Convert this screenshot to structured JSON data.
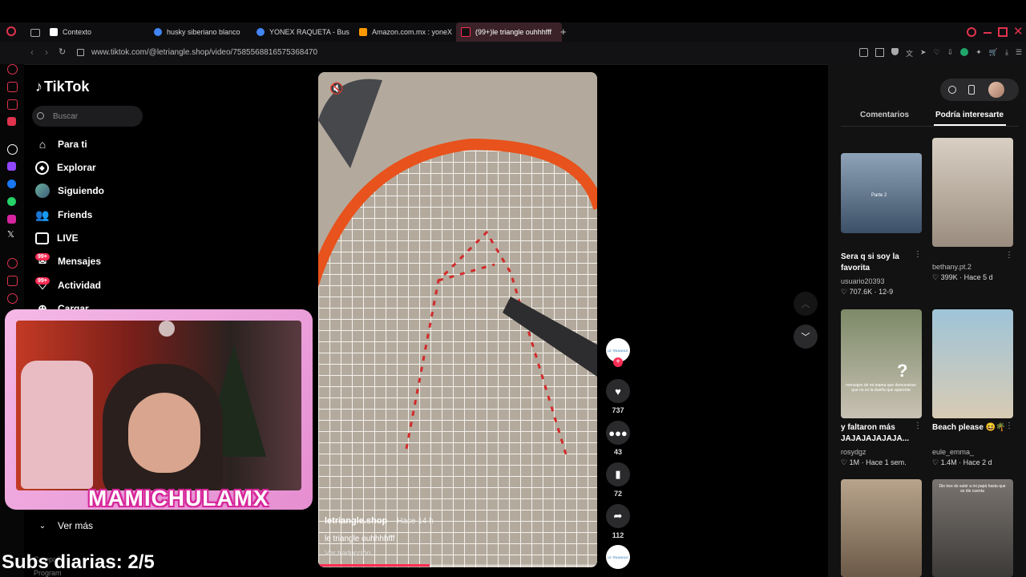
{
  "browser": {
    "tabs": [
      {
        "label": "Contexto",
        "color": "#ffffff"
      },
      {
        "label": "husky siberiano blanco -",
        "color": "#4285f4"
      },
      {
        "label": "YONEX RAQUETA - Busc",
        "color": "#4285f4"
      },
      {
        "label": "Amazon.com.mx : yoneX",
        "color": "#ff9900"
      },
      {
        "label": "(99+)le triangle ouhhhfff",
        "color": "#111111"
      }
    ],
    "new_tab": "+",
    "url": "www.tiktok.com/@letriangle.shop/video/7585568816575368470"
  },
  "tiktok": {
    "logo": "TikTok",
    "search_placeholder": "Buscar",
    "nav": [
      {
        "label": "Para ti",
        "icon": "home-icon"
      },
      {
        "label": "Explorar",
        "icon": "compass-icon"
      },
      {
        "label": "Siguiendo",
        "icon": "avatar-icon"
      },
      {
        "label": "Friends",
        "icon": "friends-icon"
      },
      {
        "label": "LIVE",
        "icon": "live-icon"
      },
      {
        "label": "Mensajes",
        "icon": "message-icon",
        "badge": "99+"
      },
      {
        "label": "Actividad",
        "icon": "activity-icon",
        "badge": "99+"
      },
      {
        "label": "Cargar",
        "icon": "upload-icon"
      }
    ],
    "ver_mas": "Ver más",
    "footer1": "Compañ",
    "footer2": "Program"
  },
  "video": {
    "author": "letriangle.shop",
    "time": "· Hace 14 h",
    "caption": "le triangle ouhhhhfff",
    "translate": "Ver traducción",
    "progress": 0.4,
    "likes": "737",
    "comments": "43",
    "saves": "72",
    "shares": "112",
    "avatar_text": "LE TRIANGLE"
  },
  "overlay": {
    "streamer": "MAMICHULAMX",
    "subs": "Subs diarias: 2/5"
  },
  "panel": {
    "tabs": [
      "Comentarios",
      "Podría interesarte"
    ],
    "active_tab": 1,
    "items": [
      {
        "caption": "Sera q si soy la favorita",
        "user": "usuario20393",
        "likes": "707.6K",
        "date": "12-9",
        "thumb_text": "Parte 2",
        "c1": "#8fa3b8",
        "c2": "#3b4f66"
      },
      {
        "caption": "",
        "user": "bethany.pt.2",
        "likes": "399K",
        "date": "Hace 5 d",
        "thumb_text": "",
        "c1": "#d9cfc3",
        "c2": "#9a8d7f"
      },
      {
        "caption": "y faltaron más JAJAJAJAJAJA...",
        "user": "rosydgz",
        "likes": "1M",
        "date": "Hace 1 sem.",
        "thumb_text": "mensajes de mi mama que demuestran que no es la dueña que aparenta",
        "c1": "#7d8a68",
        "c2": "#c9c2b4"
      },
      {
        "caption": "Beach please 😆🌴",
        "user": "eule_emma_",
        "likes": "1.4M",
        "date": "Hace 2 d",
        "thumb_text": "",
        "c1": "#9fc4d8",
        "c2": "#d8cbb4"
      },
      {
        "caption": "",
        "user": "",
        "likes": "",
        "date": "",
        "thumb_text": "",
        "c1": "#b8a48c",
        "c2": "#6b5a48"
      },
      {
        "caption": "",
        "user": "",
        "likes": "",
        "date": "",
        "thumb_text": "Dio tres de subir a mi papá hasta que se dio cuenta",
        "c1": "#7a7470",
        "c2": "#3c3a38"
      }
    ]
  },
  "colors": {
    "accent": "#fe2c55",
    "tab_active": "#3a2228",
    "cam_frame": "#f4b8e6"
  }
}
